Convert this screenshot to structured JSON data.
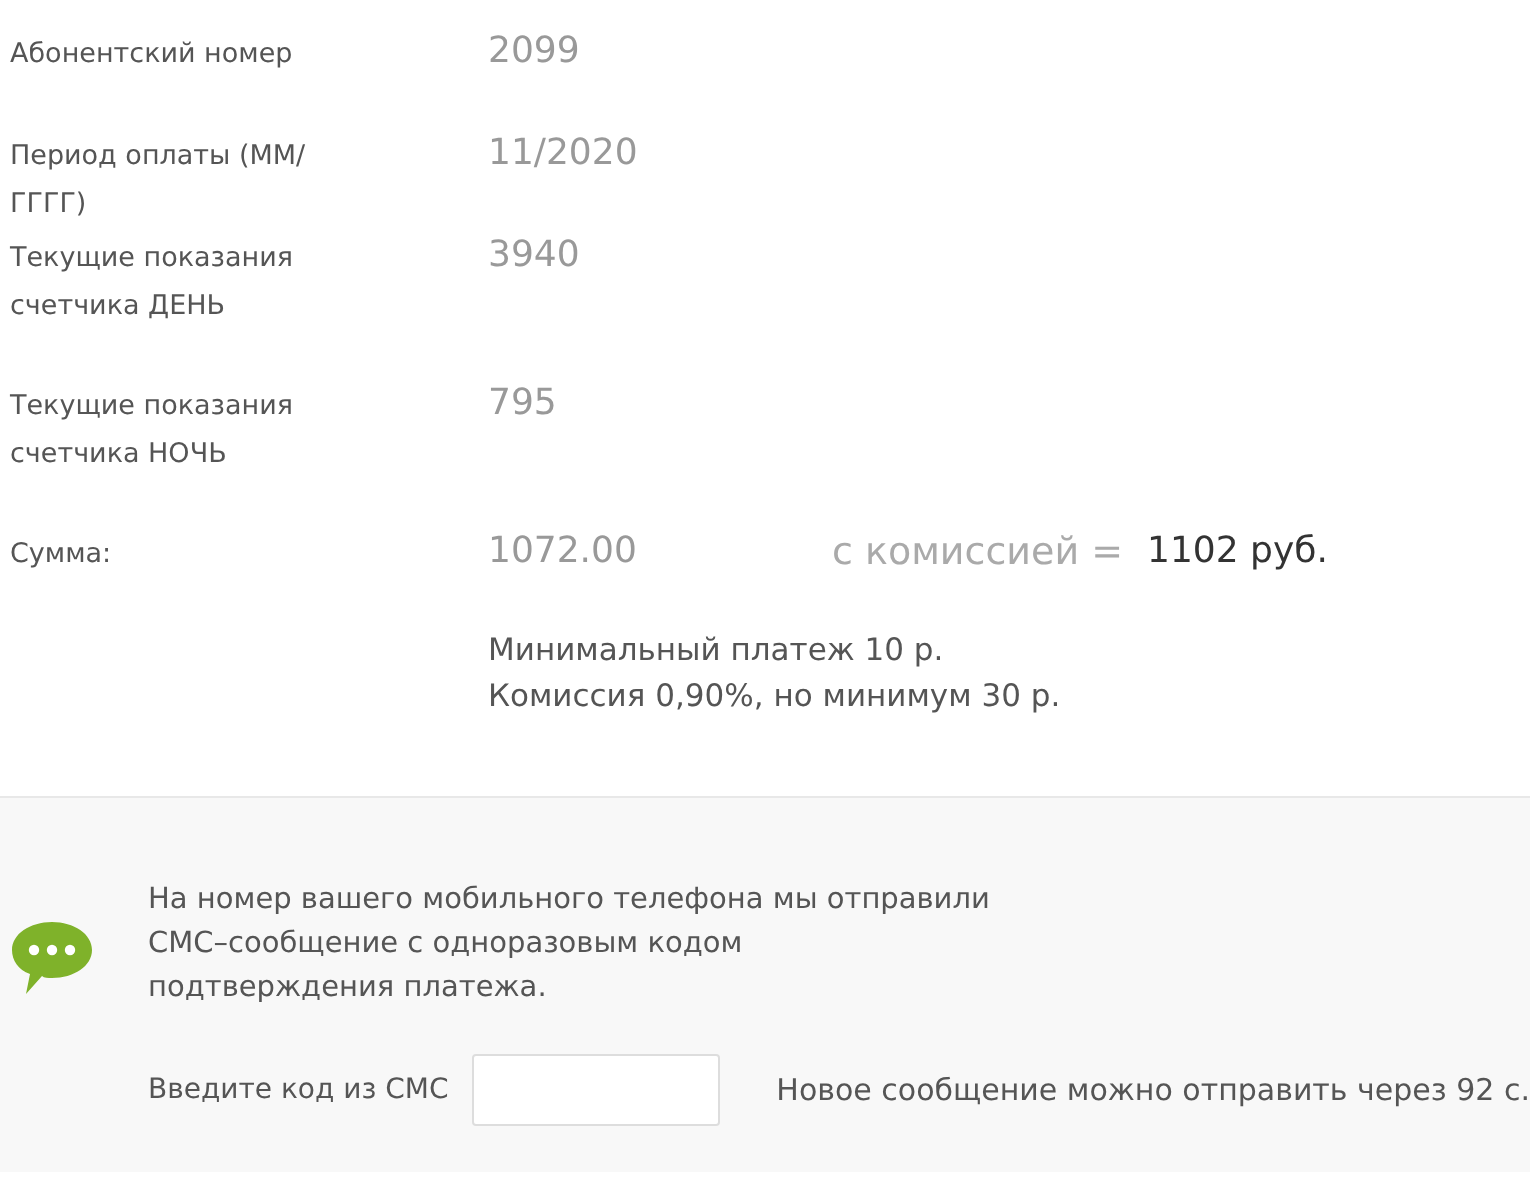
{
  "fields": [
    {
      "label": "Абонентский номер",
      "value": "2099"
    },
    {
      "label": "Период оплаты (ММ/ГГГГ)",
      "value": "11/2020"
    },
    {
      "label": "Текущие показания счетчика ДЕНЬ",
      "value": "3940"
    },
    {
      "label": "Текущие показания счетчика НОЧЬ",
      "value": "795"
    }
  ],
  "sum": {
    "label": "Сумма:",
    "value": "1072.00",
    "commission_label": "с комиссией =",
    "total": "1102 руб."
  },
  "notes": [
    "Минимальный платеж 10 р.",
    "Комиссия 0,90%, но минимум 30 р."
  ],
  "sms": {
    "message": [
      "На номер вашего мобильного телефона мы отправили",
      "СМС–сообщение с одноразовым кодом",
      "подтверждения платежа."
    ],
    "code_label": "Введите код из СМС",
    "resend_note": "Новое сообщение можно отправить через 92 с."
  }
}
